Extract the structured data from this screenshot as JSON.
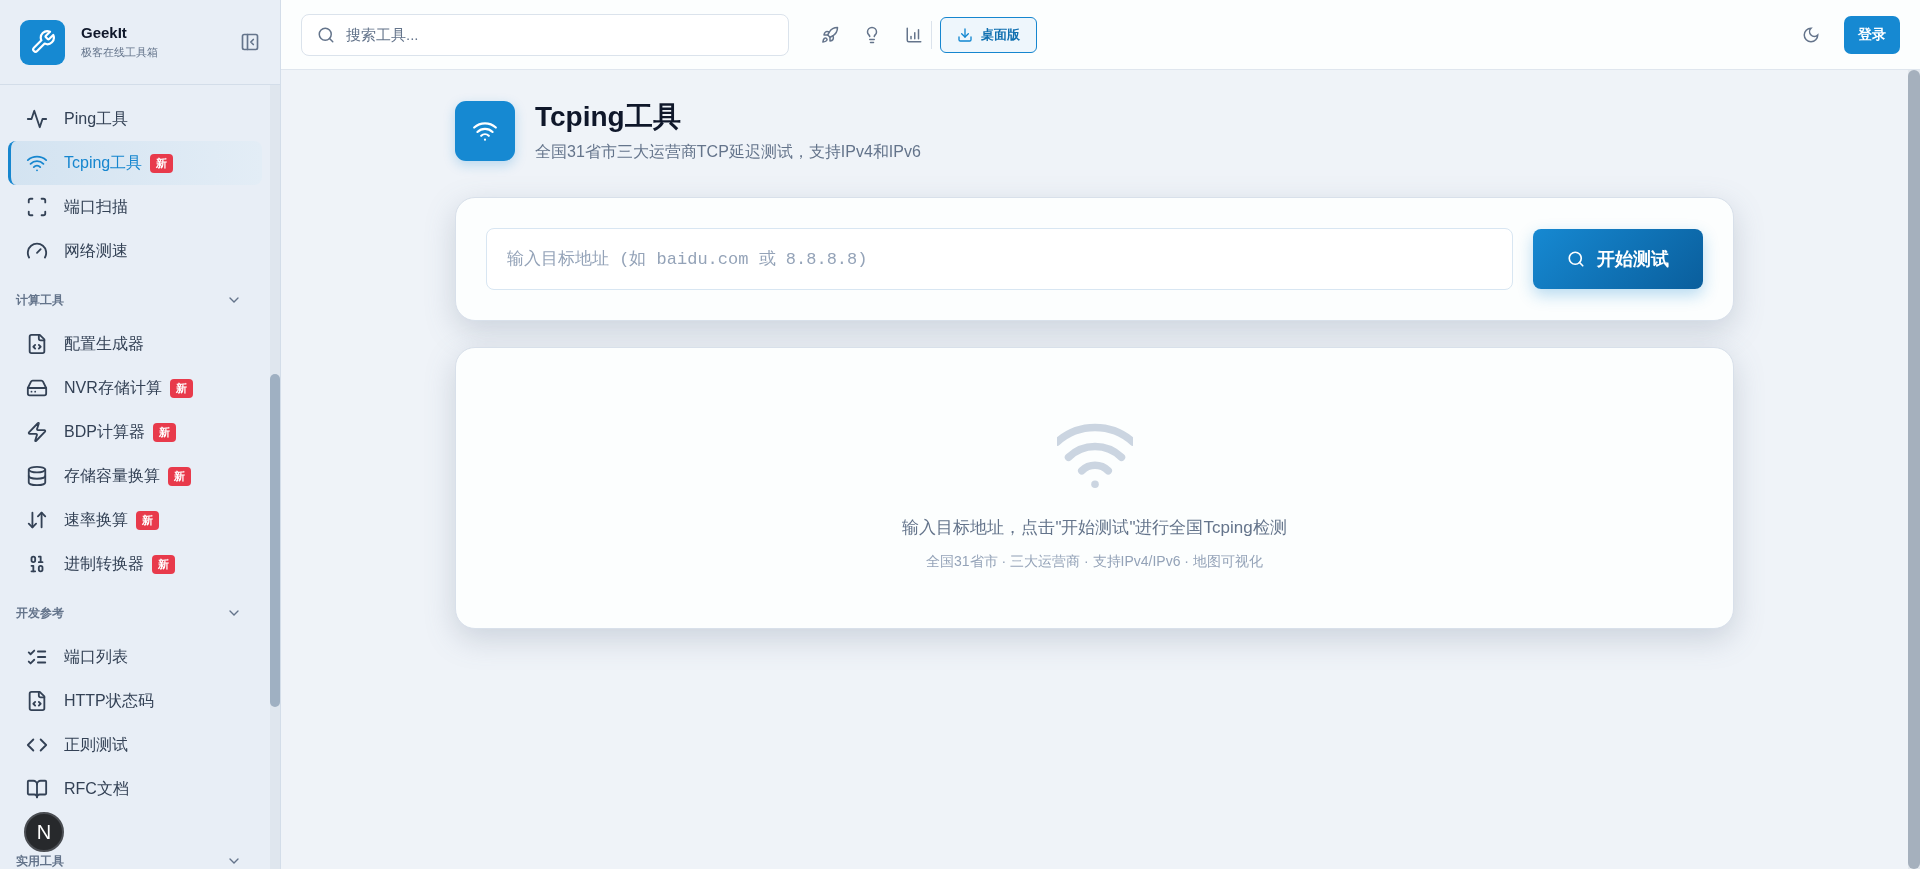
{
  "sidebar": {
    "logo": {
      "title": "GeekIt",
      "subtitle": "极客在线工具箱"
    },
    "sections": [
      {
        "items": [
          {
            "label": "Ping工具",
            "kind": "activity",
            "selected": false
          },
          {
            "label": "Tcping工具",
            "kind": "wifi",
            "badge": "新",
            "selected": true
          },
          {
            "label": "端口扫描",
            "kind": "scan",
            "selected": false
          },
          {
            "label": "网络测速",
            "kind": "gauge",
            "selected": false
          }
        ]
      },
      {
        "heading": "计算工具",
        "expanded": true,
        "items": [
          {
            "label": "配置生成器",
            "kind": "file-code",
            "selected": false
          },
          {
            "label": "NVR存储计算",
            "kind": "hard-drive",
            "badge": "新",
            "selected": false
          },
          {
            "label": "BDP计算器",
            "kind": "zap",
            "badge": "新",
            "selected": false
          },
          {
            "label": "存储容量换算",
            "kind": "database",
            "badge": "新",
            "selected": false
          },
          {
            "label": "速率换算",
            "kind": "arrows",
            "badge": "新",
            "selected": false
          },
          {
            "label": "进制转换器",
            "kind": "binary",
            "badge": "新",
            "selected": false
          }
        ]
      },
      {
        "heading": "开发参考",
        "expanded": true,
        "items": [
          {
            "label": "端口列表",
            "kind": "list-checks",
            "selected": false
          },
          {
            "label": "HTTP状态码",
            "kind": "file-code",
            "selected": false
          },
          {
            "label": "正则测试",
            "kind": "code",
            "selected": false
          },
          {
            "label": "RFC文档",
            "kind": "book",
            "selected": false
          }
        ]
      },
      {
        "heading": "实用工具",
        "expanded": true
      }
    ],
    "dev_badge": {
      "label": "N"
    }
  },
  "topbar": {
    "search": {
      "placeholder": "搜索工具..."
    },
    "desktop_button": "桌面版",
    "login_button": "登录"
  },
  "tool": {
    "title": "Tcping工具",
    "subtitle": "全国31省市三大运营商TCP延迟测试，支持IPv4和IPv6",
    "input": {
      "placeholder": "输入目标地址 (如 baidu.com 或 8.8.8.8)"
    },
    "start_button": "开始测试",
    "empty_state": {
      "message": "输入目标地址，点击\"开始测试\"进行全国Tcping检测",
      "features": "全国31省市 · 三大运营商 · 支持IPv4/IPv6 · 地图可视化"
    }
  }
}
